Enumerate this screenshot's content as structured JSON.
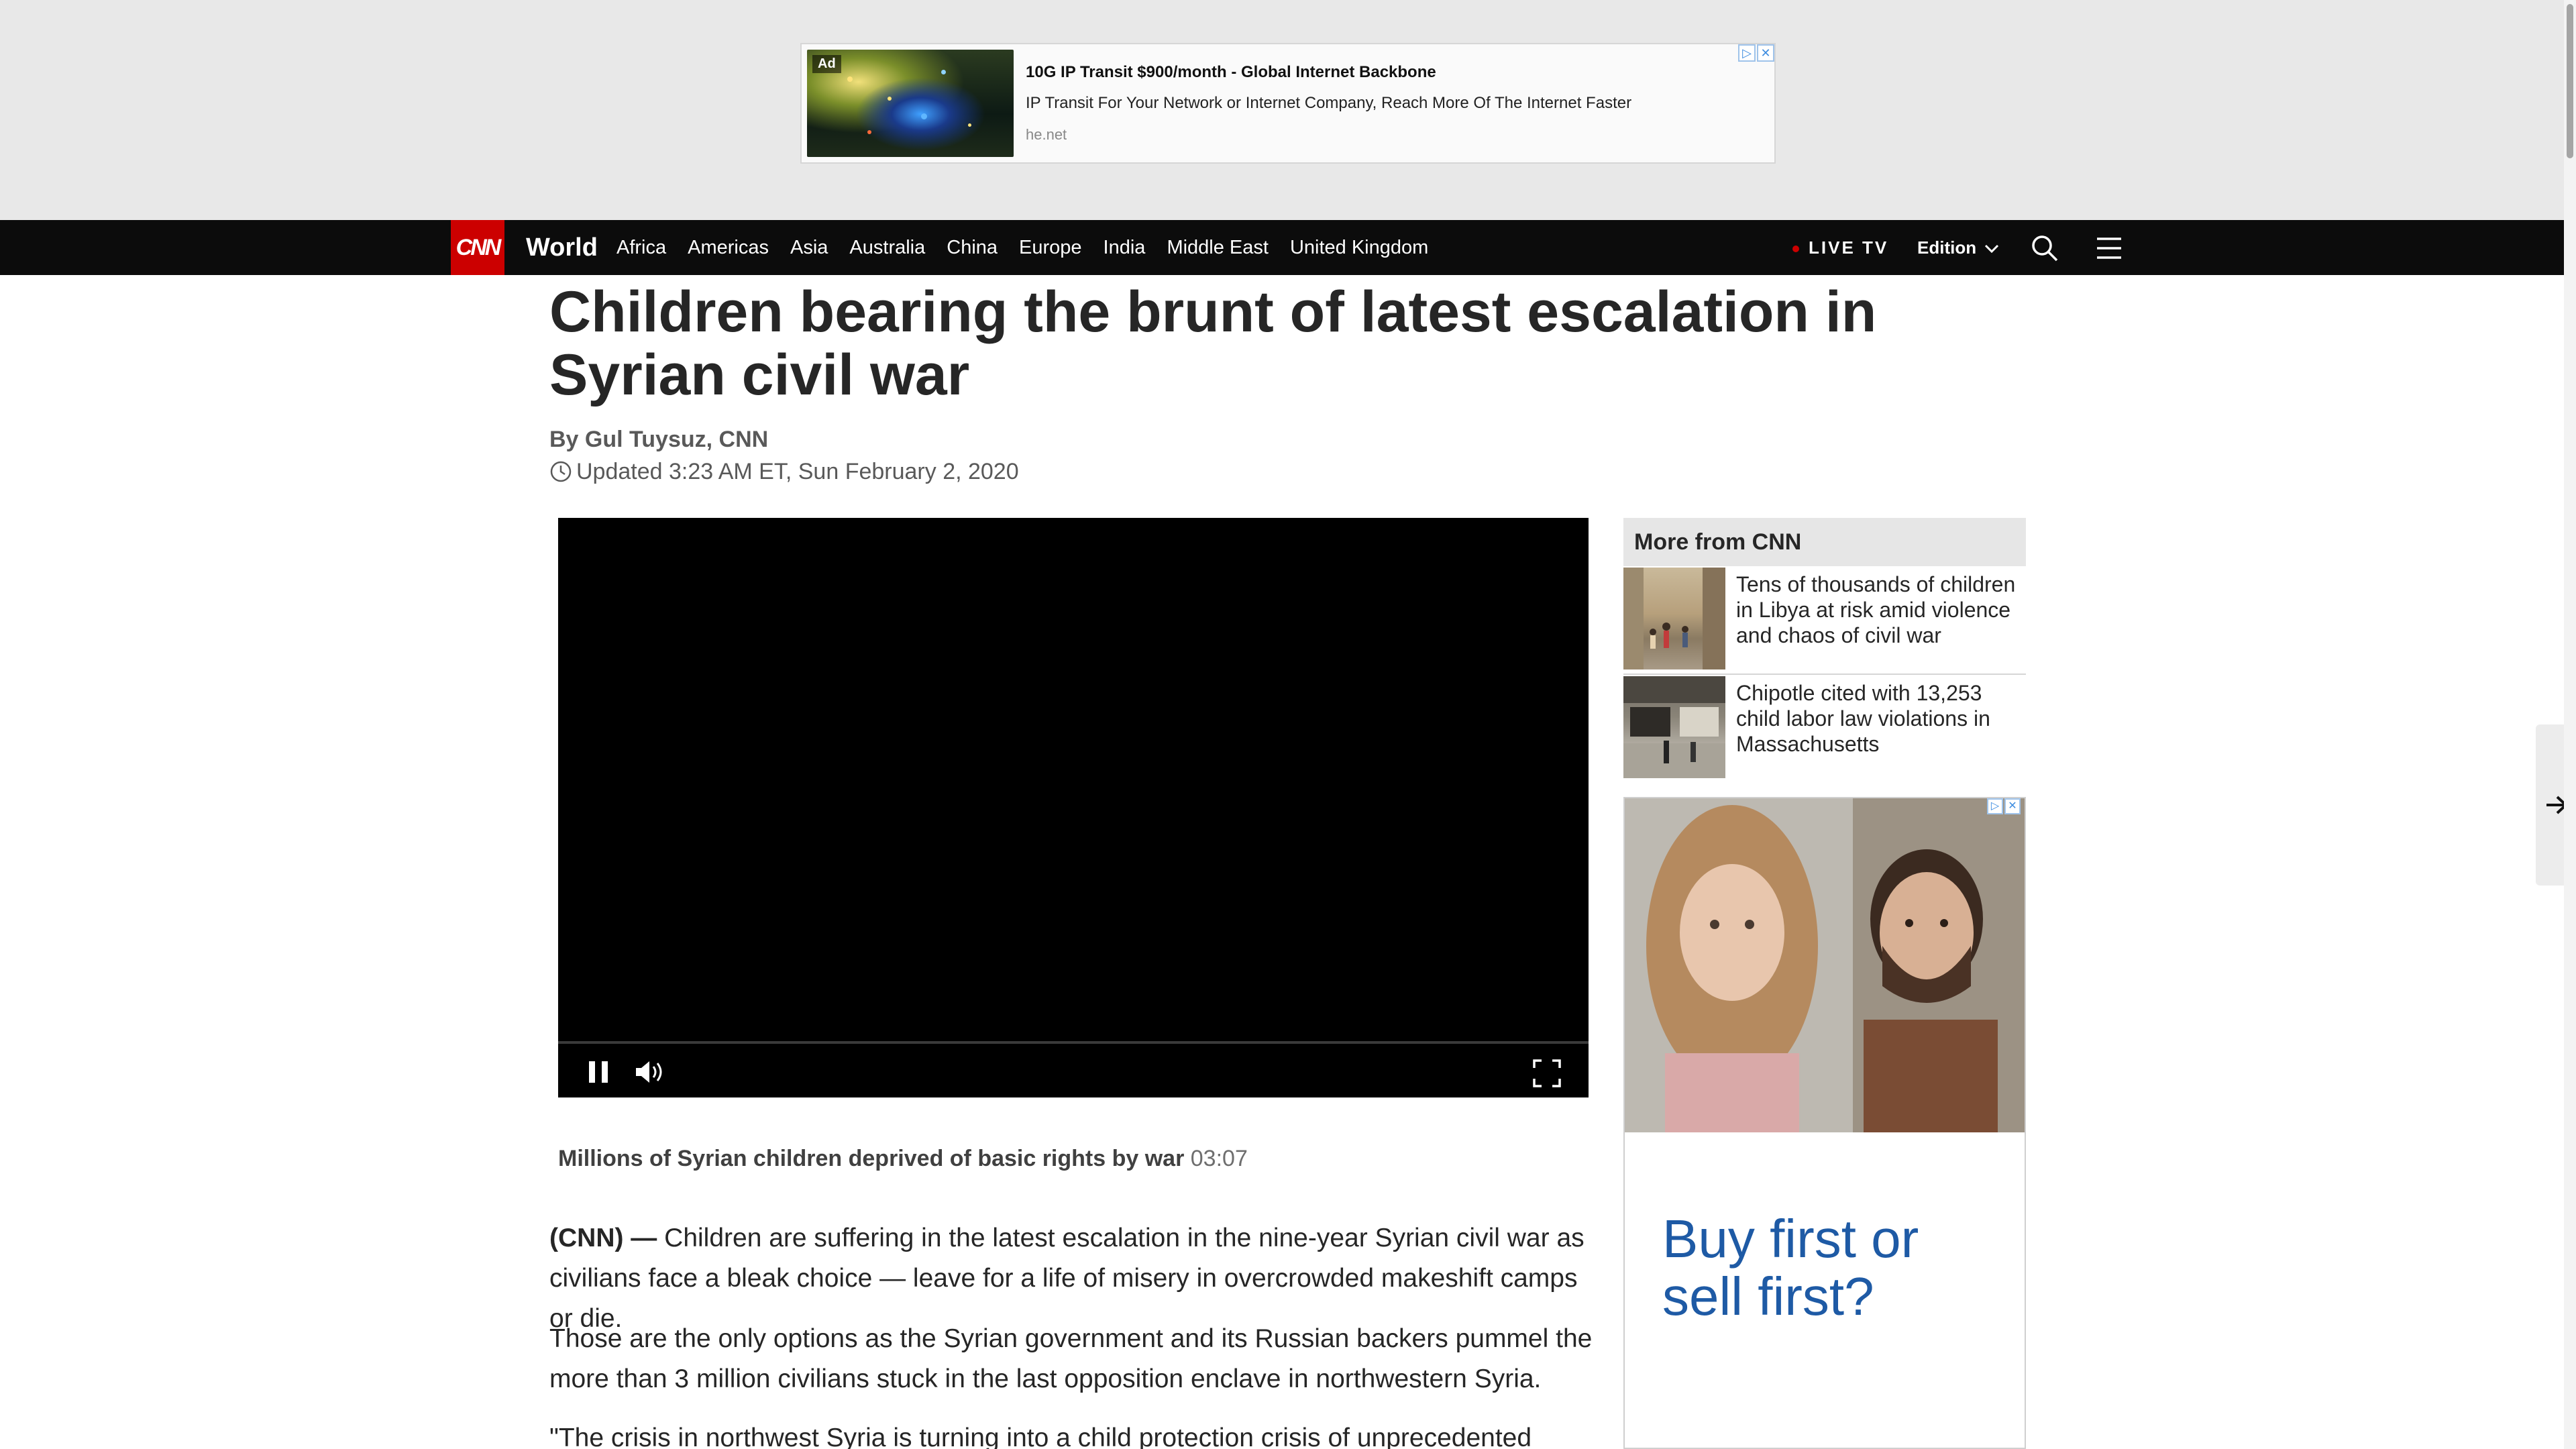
{
  "top_ad": {
    "tag": "Ad",
    "title": "10G IP Transit $900/month - Global Internet Backbone",
    "description": "IP Transit For Your Network or Internet Company, Reach More Of The Internet Faster",
    "url": "he.net"
  },
  "nav": {
    "logo": "CNN",
    "section": "World",
    "links": [
      "Africa",
      "Americas",
      "Asia",
      "Australia",
      "China",
      "Europe",
      "India",
      "Middle East",
      "United Kingdom"
    ],
    "live_tv": "LIVE TV",
    "edition": "Edition"
  },
  "article": {
    "headline": "Children bearing the brunt of latest escalation in Syrian civil war",
    "byline": "By Gul Tuysuz, CNN",
    "updated": "Updated 3:23 AM ET, Sun February 2, 2020",
    "video_caption": "Millions of Syrian children deprived of basic rights by war",
    "video_duration": "03:07",
    "dateline": "(CNN) —",
    "paragraphs": [
      "Children are suffering in the latest escalation in the nine-year Syrian civil war as civilians face a bleak choice — leave for a life of misery in overcrowded makeshift camps or die.",
      "Those are the only options as the Syrian government and its Russian backers pummel the more than 3 million civilians stuck in the last opposition enclave in northwestern Syria.",
      "\"The crisis in northwest Syria is turning into a child protection crisis of unprecedented scale."
    ]
  },
  "rail": {
    "heading": "More from CNN",
    "items": [
      {
        "text": "Tens of thousands of children in Libya at risk amid violence and chaos of civil war"
      },
      {
        "text": "Chipotle cited with 13,253 child labor law violations in Massachusetts"
      }
    ],
    "ad_text": "Buy first or sell first?"
  },
  "colors": {
    "cnn_red": "#cc0000",
    "nav_bg": "#0c0c0c",
    "ad_blue": "#1e5aa5"
  }
}
